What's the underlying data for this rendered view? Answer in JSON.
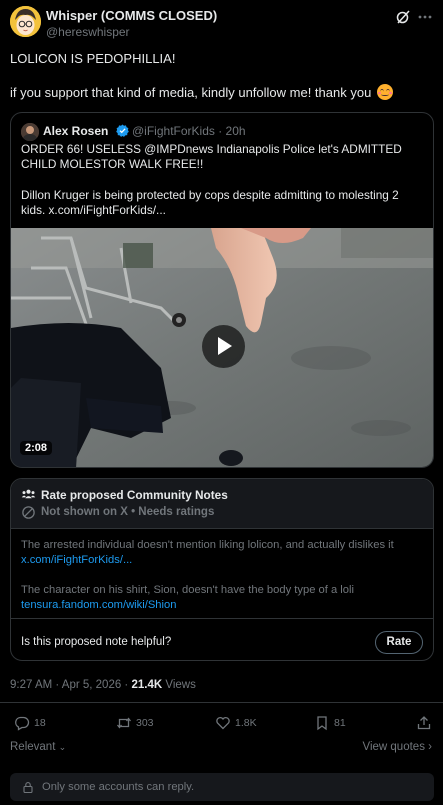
{
  "post": {
    "author_name": "Whisper (COMMS CLOSED)",
    "author_handle": "@hereswhisper",
    "text_line1": "LOLICON IS PEDOPHILLIA!",
    "text_line2": "if you support that kind of media, kindly unfollow me! thank you",
    "text_emoji": "smiling-face-emoji"
  },
  "quote": {
    "author_name": "Alex Rosen",
    "author_handle": "@iFightForKids · 20h",
    "body_line1": "ORDER 66! USELESS @IMPDnews Indianapolis Police let's ADMITTED CHILD MOLESTOR WALK FREE!!",
    "body_line2": "Dillon Kruger is being protected by cops despite admitting to molesting 2 kids. x.com/iFightForKids/...",
    "video_duration": "2:08"
  },
  "community_notes": {
    "title": "Rate proposed Community Notes",
    "status": "Not shown on X • Needs ratings",
    "note1_text": "The arrested individual doesn't mention liking lolicon, and actually dislikes it",
    "note1_link": "x.com/iFightForKids/...",
    "note2_text": "The character on his shirt, Sion, doesn't have the body type of a loli",
    "note2_link": "tensura.fandom.com/wiki/Shion",
    "helpful_question": "Is this proposed note helpful?",
    "rate_label": "Rate"
  },
  "meta": {
    "time_date": "9:27 AM · Apr 5, 2026 · ",
    "views_count": "21.4K",
    "views_label": " Views"
  },
  "actions": {
    "replies": "18",
    "reposts": "303",
    "likes": "1.8K",
    "bookmarks": "81"
  },
  "sort": {
    "relevant_label": "Relevant",
    "view_quotes_label": "View quotes"
  },
  "reply_restriction": "Only some accounts can reply.",
  "colors": {
    "background": "#000000",
    "text_primary": "#e7e9ea",
    "text_secondary": "#71767b",
    "link": "#1d9bf0",
    "border": "#2f3336"
  }
}
